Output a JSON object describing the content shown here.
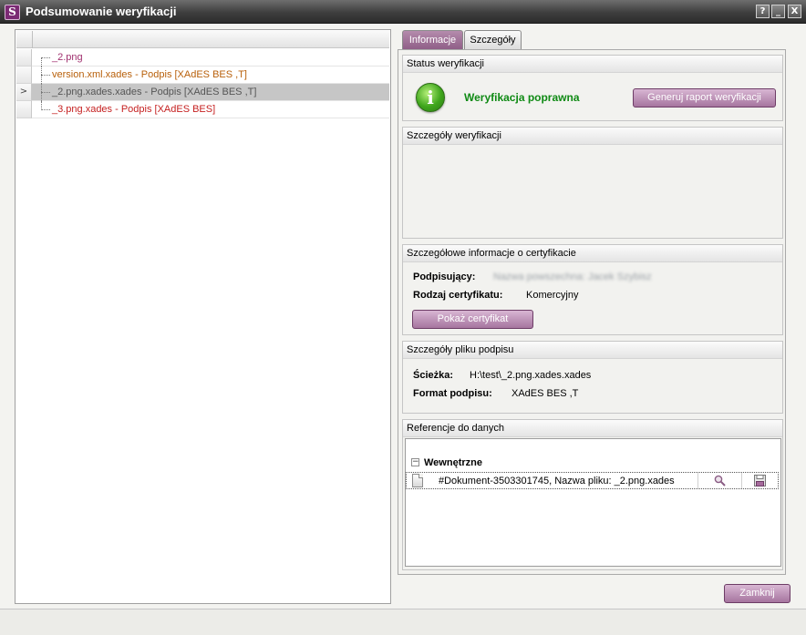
{
  "window": {
    "title": "Podsumowanie weryfikacji",
    "icon_glyph": "S",
    "help_glyph": "?",
    "minimize_glyph": "_",
    "close_glyph": "X"
  },
  "tree": {
    "items": [
      {
        "label": "_2.png",
        "color": "#a0306e",
        "selected": false
      },
      {
        "label": "version.xml.xades - Podpis [XAdES BES ,T]",
        "color": "#b8600b",
        "selected": false
      },
      {
        "label": "_2.png.xades.xades - Podpis [XAdES BES ,T]",
        "color": "#555555",
        "selected": true
      },
      {
        "label": "_3.png.xades - Podpis [XAdES BES]",
        "color": "#c51f1f",
        "selected": false
      }
    ],
    "selected_marker": ">"
  },
  "tabs": {
    "info": "Informacje",
    "details": "Szczegóły",
    "active": "info"
  },
  "status_group": {
    "title": "Status weryfikacji",
    "icon": "info-icon",
    "icon_glyph": "i",
    "text": "Weryfikacja poprawna",
    "button": "Generuj raport weryfikacji"
  },
  "details_group": {
    "title": "Szczegóły weryfikacji"
  },
  "cert_group": {
    "title": "Szczegółowe informacje o certyfikacie",
    "signer_label": "Podpisujący:",
    "signer_value": "Nazwa powszechna: Jacek Szybisz",
    "type_label": "Rodzaj certyfikatu:",
    "type_value": "Komercyjny",
    "button": "Pokaż certyfikat"
  },
  "file_group": {
    "title": "Szczegóły pliku podpisu",
    "path_label": "Ścieżka:",
    "path_value": "H:\\test\\_2.png.xades.xades",
    "format_label": "Format podpisu:",
    "format_value": "XAdES BES ,T"
  },
  "ref_group": {
    "title": "Referencje do danych",
    "expander_glyph": "−",
    "section": "Wewnętrzne",
    "item": "#Dokument-3503301745,  Nazwa pliku: _2.png.xades"
  },
  "footer": {
    "close_button": "Zamknij"
  },
  "colors": {
    "accent": "#9e6a96",
    "ok_green": "#0f8a14"
  }
}
